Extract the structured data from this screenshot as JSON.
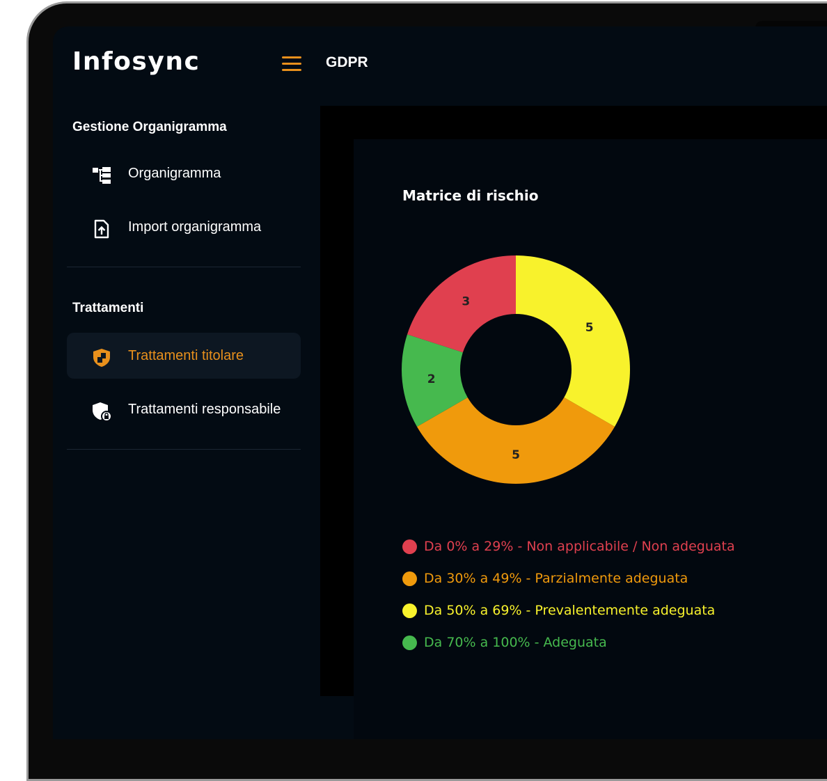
{
  "app": {
    "logo": "Infosync",
    "page_title": "GDPR"
  },
  "sidebar": {
    "sections": [
      {
        "title": "Gestione Organigramma",
        "items": [
          {
            "label": "Organigramma",
            "icon": "org-chart-icon",
            "active": false
          },
          {
            "label": "Import organigramma",
            "icon": "file-upload-icon",
            "active": false
          }
        ]
      },
      {
        "title": "Trattamenti",
        "items": [
          {
            "label": "Trattamenti titolare",
            "icon": "shield-icon",
            "active": true
          },
          {
            "label": "Trattamenti responsabile",
            "icon": "shield-lock-icon",
            "active": false
          }
        ]
      }
    ]
  },
  "colors": {
    "accent": "#e8901c",
    "red": "#e0404f",
    "orange": "#f09a0c",
    "yellow": "#f8f22c",
    "green": "#46b94e"
  },
  "main": {
    "card_title": "Matrice di rischio"
  },
  "chart_data": {
    "type": "pie",
    "title": "Matrice di rischio",
    "series": [
      {
        "name": "Da 0% a 29% - Non applicabile / Non adeguata",
        "value": 3,
        "color": "#e0404f"
      },
      {
        "name": "Da 30% a 49% - Parzialmente adeguata",
        "value": 5,
        "color": "#f09a0c"
      },
      {
        "name": "Da 50% a 69% - Prevalentemente adeguata",
        "value": 5,
        "color": "#f8f22c"
      },
      {
        "name": "Da 70% a 100% - Adeguata",
        "value": 2,
        "color": "#46b94e"
      }
    ],
    "slice_order": [
      2,
      1,
      3,
      0
    ],
    "legend_position": "bottom"
  }
}
